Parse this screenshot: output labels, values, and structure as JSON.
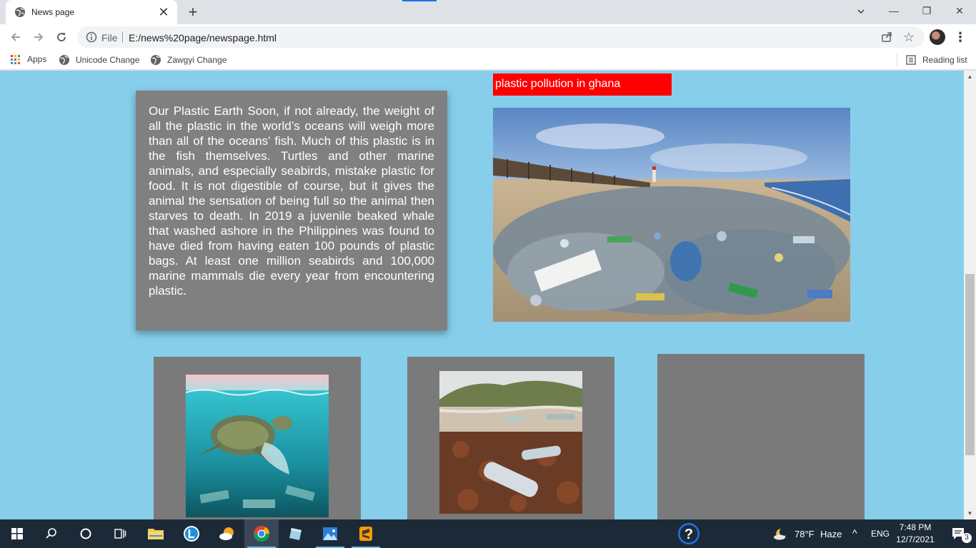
{
  "browser": {
    "tab": {
      "title": "News page",
      "close": "✕"
    },
    "new_tab": "+",
    "window": {
      "minimize": "—",
      "restore": "❐",
      "close": "✕"
    },
    "address": {
      "scheme_label": "File",
      "url": "E:/news%20page/newspage.html"
    },
    "menu": "⋮",
    "bookmarks": {
      "apps": "Apps",
      "items": [
        "Unicode Change",
        "Zawgyi Change"
      ],
      "reading_list": "Reading list"
    }
  },
  "page": {
    "headline": "plastic pollution in ghana",
    "article_text": "Our Plastic Earth Soon, if not already, the weight of all the plastic in the world’s oceans will weigh more than all of the oceans’ fish. Much of this plastic is in the fish themselves. Turtles and other marine animals, and especially seabirds, mistake plastic for food. It is not digestible of course, but it gives the animal the sensation of being full so the animal then starves to death. In 2019 a juvenile beaked whale that washed ashore in the Philippines was found to have died from having eaten 100 pounds of plastic bags. At least one million seabirds and 100,000 marine mammals die every year from encountering plastic.",
    "colors": {
      "background": "#87ceeb",
      "headline_bg": "#ff0000",
      "article_bg": "#808080",
      "card_bg": "#7a7a7a"
    },
    "images": {
      "hero": "beach-plastic-pollution-image",
      "card1": "turtle-plastic-bag-image",
      "card2": "bottles-on-seaweed-shore-image"
    }
  },
  "taskbar": {
    "weather": {
      "temp": "78°F",
      "condition": "Haze"
    },
    "language": "ENG",
    "time": "7:48 PM",
    "date": "12/7/2021",
    "notifications": "3"
  }
}
